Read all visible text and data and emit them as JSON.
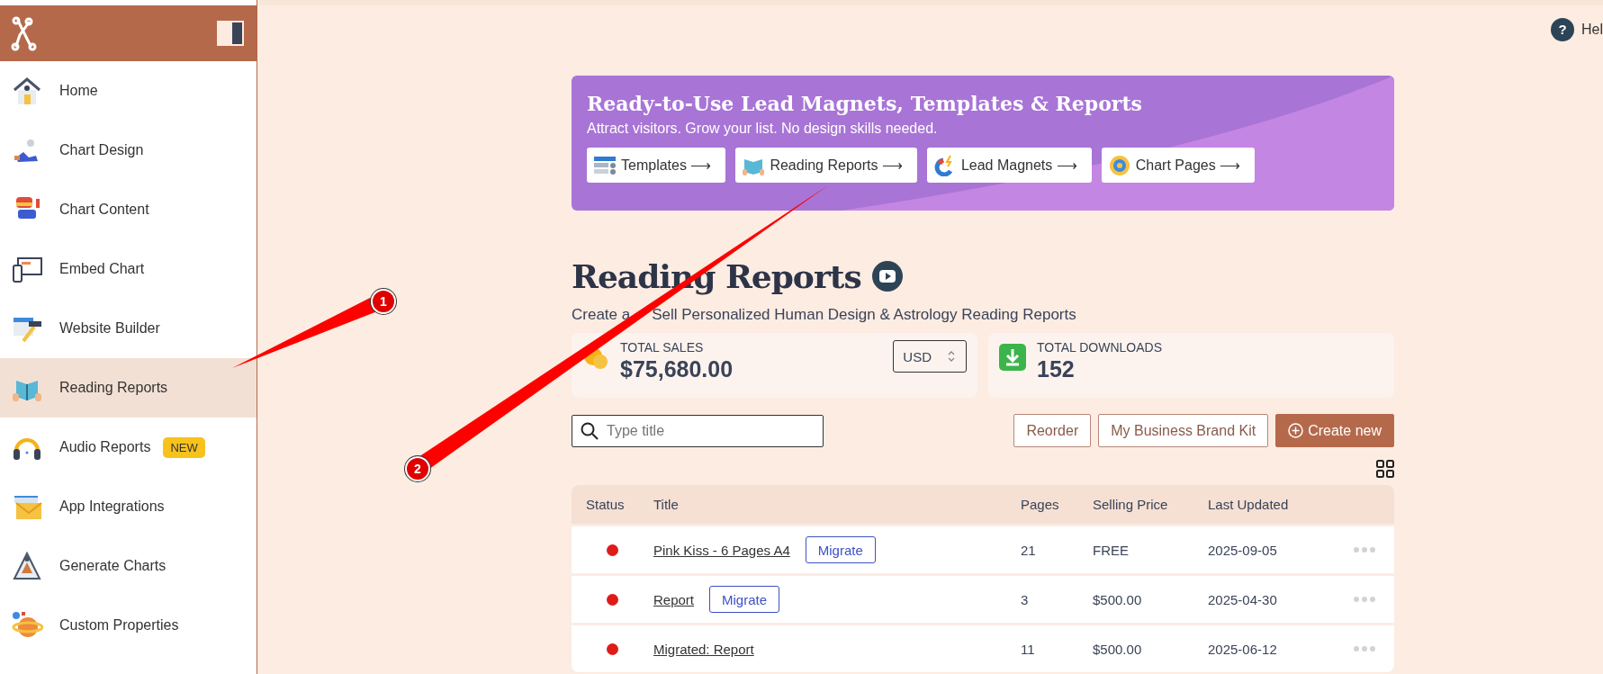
{
  "sidebar": {
    "items": [
      {
        "label": "Home",
        "selected": false
      },
      {
        "label": "Chart Design",
        "selected": false
      },
      {
        "label": "Chart Content",
        "selected": false
      },
      {
        "label": "Embed Chart",
        "selected": false
      },
      {
        "label": "Website Builder",
        "selected": false
      },
      {
        "label": "Reading Reports",
        "selected": true
      },
      {
        "label": "Audio Reports",
        "selected": false,
        "badge": "NEW"
      },
      {
        "label": "App Integrations",
        "selected": false
      },
      {
        "label": "Generate Charts",
        "selected": false
      },
      {
        "label": "Custom Properties",
        "selected": false
      }
    ]
  },
  "help": {
    "icon": "?",
    "label": "Hel"
  },
  "banner": {
    "title": "Ready-to-Use Lead Magnets, Templates & Reports",
    "subtitle": "Attract visitors. Grow your list. No design skills needed.",
    "links": [
      {
        "label": "Templates ⟶"
      },
      {
        "label": "Reading Reports ⟶"
      },
      {
        "label": "Lead Magnets ⟶"
      },
      {
        "label": "Chart Pages ⟶"
      }
    ]
  },
  "page": {
    "title": "Reading Reports",
    "subtitle_parts": [
      "Create a",
      "Sell Personalized Human Design & Astrology Reading Reports"
    ]
  },
  "stats": [
    {
      "label": "TOTAL SALES",
      "value": "$75,680.00",
      "currency": "USD"
    },
    {
      "label": "TOTAL DOWNLOADS",
      "value": "152"
    }
  ],
  "toolbar": {
    "search": {
      "placeholder": "Type title"
    },
    "buttons": [
      {
        "label": "Reorder",
        "kind": "outline"
      },
      {
        "label": "My Business Brand Kit",
        "kind": "outline"
      },
      {
        "label": "Create new",
        "kind": "primary"
      }
    ]
  },
  "table": {
    "columns": [
      "Status",
      "Title",
      "Pages",
      "Selling Price",
      "Last Updated"
    ],
    "rows": [
      {
        "color": "#dd1c1a",
        "title": "Pink Kiss - 6 Pages A4",
        "action": "Migrate",
        "pages": "21",
        "price": "FREE",
        "updated": "2025-09-05"
      },
      {
        "color": "#dd1c1a",
        "title": "Report",
        "action": "Migrate",
        "pages": "3",
        "price": "$500.00",
        "updated": "2025-04-30"
      },
      {
        "color": "#dd1c1a",
        "title": "Migrated: Report",
        "pages": "11",
        "price": "$500.00",
        "updated": "2025-06-12"
      }
    ]
  },
  "annotations": [
    {
      "label": "1"
    },
    {
      "label": "2"
    }
  ]
}
